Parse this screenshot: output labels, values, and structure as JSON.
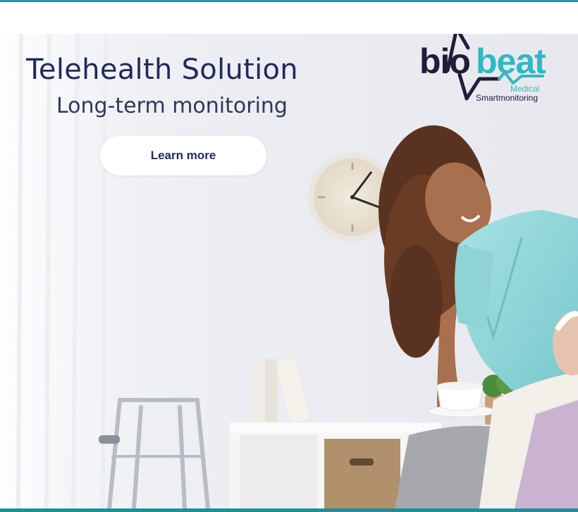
{
  "banner": {
    "headline": "Telehealth Solution",
    "subheadline": "Long-term monitoring",
    "cta_label": "Learn more"
  },
  "logo": {
    "word_part1": "bio",
    "word_part2": "beat",
    "medical": "Medical",
    "tagline": "Smartmonitoring",
    "colors": {
      "dark": "#1f1d3a",
      "teal": "#2fb8c5"
    }
  },
  "colors": {
    "headline": "#1f2a5c",
    "border": "#1d9aa5",
    "scrub": "#8fd6d8"
  }
}
